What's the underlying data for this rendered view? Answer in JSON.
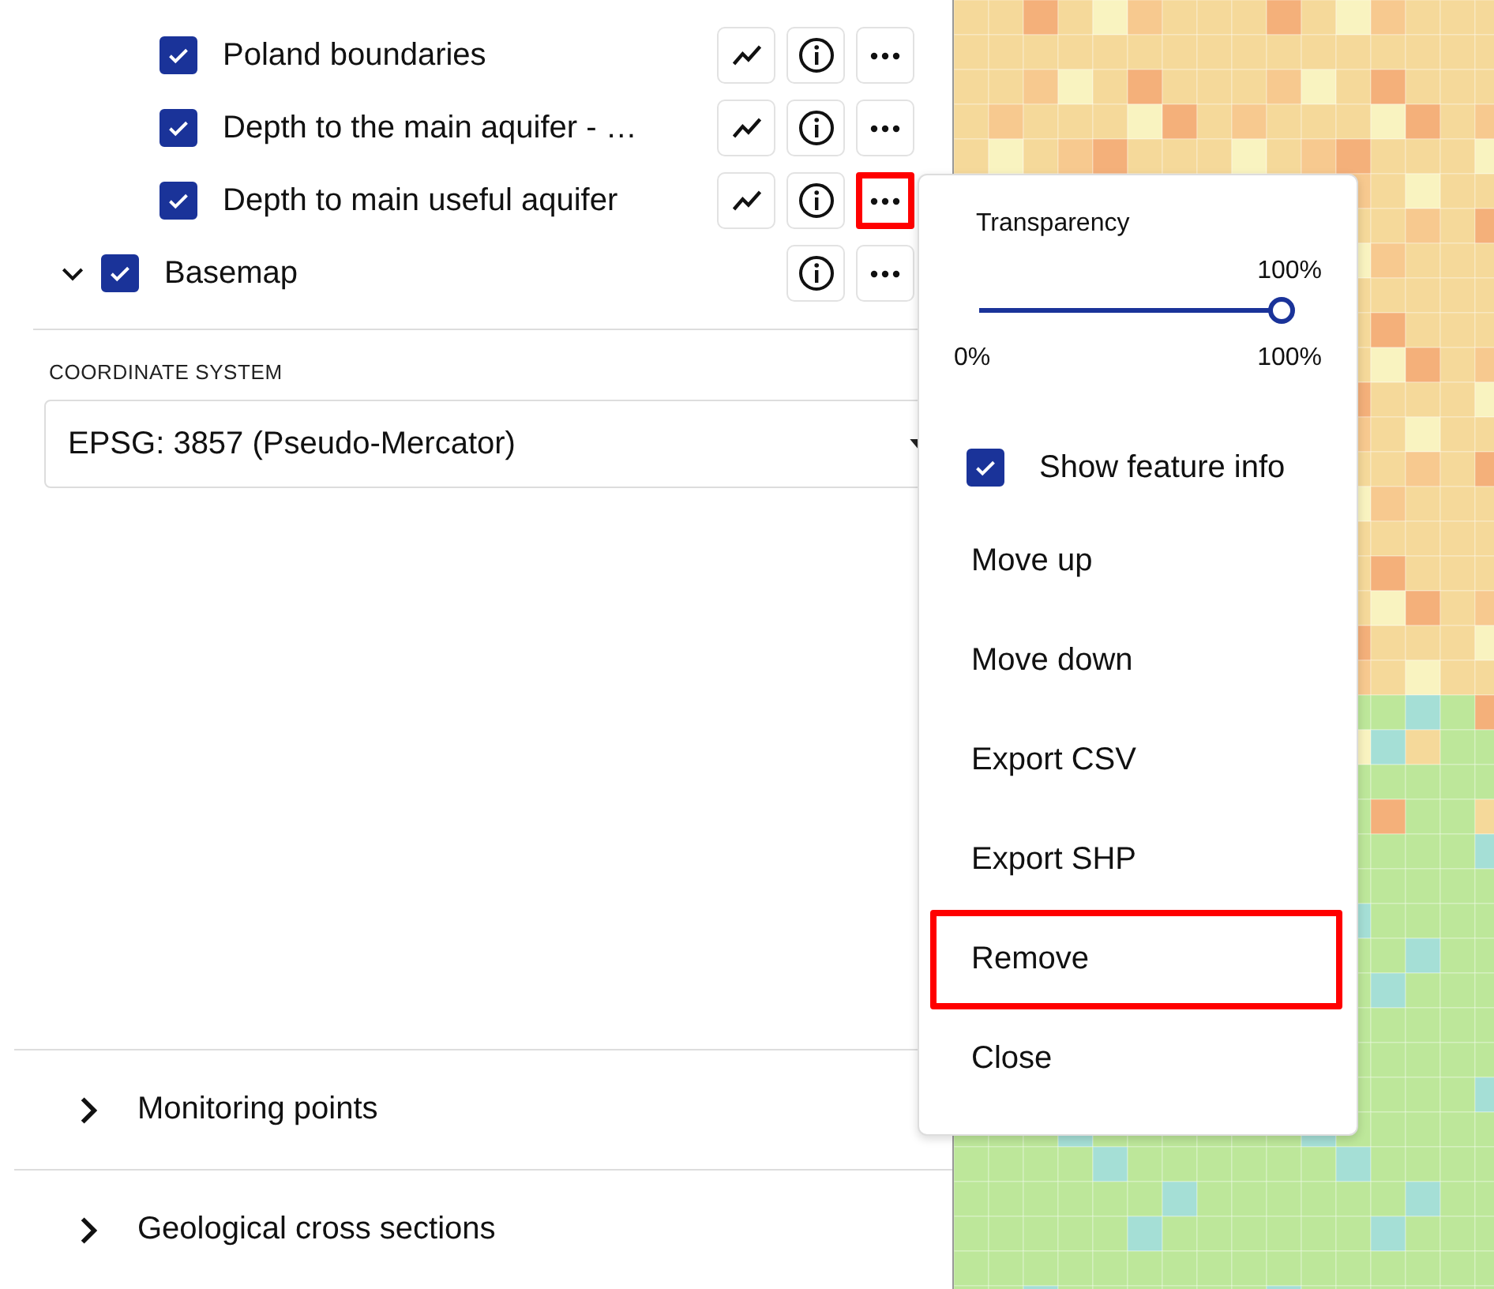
{
  "layers": [
    {
      "label": "Poland boundaries",
      "checked": true,
      "buttons": [
        {
          "kind": "chart",
          "highlighted": false
        },
        {
          "kind": "info",
          "highlighted": false
        },
        {
          "kind": "more",
          "highlighted": false
        }
      ]
    },
    {
      "label": "Depth to the main aquifer - …",
      "checked": true,
      "buttons": [
        {
          "kind": "chart",
          "highlighted": false
        },
        {
          "kind": "info",
          "highlighted": false
        },
        {
          "kind": "more",
          "highlighted": false
        }
      ]
    },
    {
      "label": "Depth to main useful aquifer",
      "checked": true,
      "buttons": [
        {
          "kind": "chart",
          "highlighted": false
        },
        {
          "kind": "info",
          "highlighted": false
        },
        {
          "kind": "more",
          "highlighted": true
        }
      ]
    }
  ],
  "groups": [
    {
      "label": "Basemap",
      "checked": true,
      "expanded": true,
      "buttons": [
        {
          "kind": "info",
          "highlighted": false
        },
        {
          "kind": "more",
          "highlighted": false
        }
      ]
    }
  ],
  "coordinate_system": {
    "label": "COORDINATE SYSTEM",
    "value": "EPSG: 3857 (Pseudo-Mercator)"
  },
  "sections": [
    {
      "label": "Monitoring points",
      "expanded": false
    },
    {
      "label": "Geological cross sections",
      "expanded": false
    }
  ],
  "layer_menu": {
    "items": [
      {
        "kind": "slider",
        "label": "Transparency",
        "reading": "100%",
        "min_label": "0%",
        "max_label": "100%",
        "level": 1
      },
      {
        "kind": "checkbox",
        "label": "Show feature info",
        "checked": true
      },
      {
        "kind": "action",
        "label": "Move up",
        "highlighted": false
      },
      {
        "kind": "action",
        "label": "Move down",
        "highlighted": false
      },
      {
        "kind": "action",
        "label": "Export CSV",
        "highlighted": false
      },
      {
        "kind": "action",
        "label": "Export SHP",
        "highlighted": false
      },
      {
        "kind": "action",
        "label": "Remove",
        "highlighted": true
      },
      {
        "kind": "action",
        "label": "Close",
        "highlighted": false
      }
    ]
  }
}
